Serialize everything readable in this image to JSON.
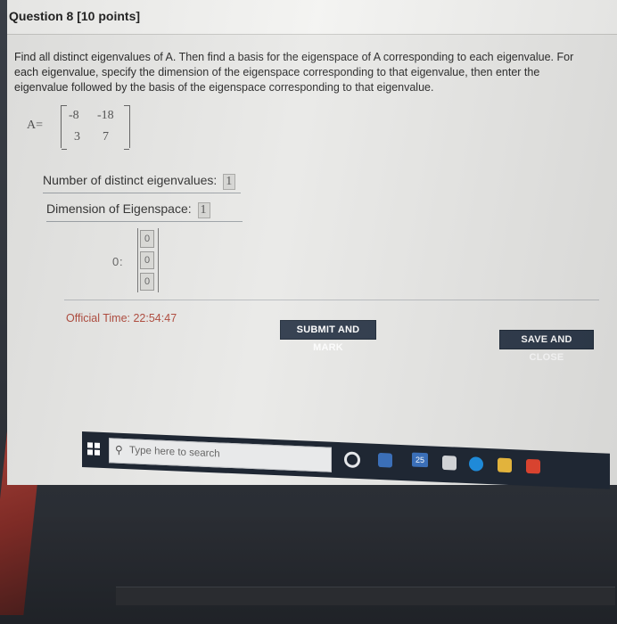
{
  "question": {
    "title": "Question 8 [10 points]",
    "prompt": "Find all distinct eigenvalues of A. Then find a basis for the eigenspace of A corresponding to each eigenvalue. For each eigenvalue, specify the dimension of the eigenspace corresponding to that eigenvalue, then enter the eigenvalue followed by the basis of the eigenspace corresponding to that eigenvalue."
  },
  "matrix": {
    "label": "A=",
    "rows": [
      [
        "-8",
        "-18"
      ],
      [
        "3",
        "7"
      ]
    ]
  },
  "distinct": {
    "label": "Number of distinct eigenvalues:",
    "value": "1"
  },
  "dimension": {
    "label": "Dimension of Eigenspace:",
    "value": "1"
  },
  "eigen_entry": {
    "eigenvalue": "0",
    "separator": ":",
    "vector": [
      "0",
      "0",
      "0"
    ]
  },
  "footer": {
    "timer": "Official Time: 22:54:47",
    "submit_label": "SUBMIT AND MARK",
    "save_label": "SAVE AND CLOSE"
  },
  "taskbar": {
    "search_placeholder": "Type here to search",
    "badge_count": "25"
  },
  "colors": {
    "accent_button": "#2e3a4b",
    "timer_text": "#b04a3c"
  }
}
